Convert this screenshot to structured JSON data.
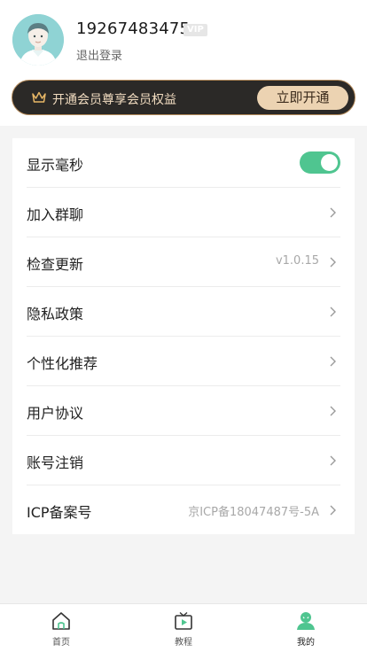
{
  "profile": {
    "phone": "19267483475",
    "vip_badge": "VIP",
    "logout_label": "退出登录"
  },
  "vip_banner": {
    "text": "开通会员尊享会员权益",
    "button_label": "立即开通"
  },
  "settings": {
    "show_ms_label": "显示毫秒",
    "show_ms_enabled": true,
    "join_group_label": "加入群聊",
    "check_update_label": "检查更新",
    "check_update_value": "v1.0.15",
    "privacy_label": "隐私政策",
    "personalized_label": "个性化推荐",
    "user_agreement_label": "用户协议",
    "account_cancel_label": "账号注销",
    "icp_label": "ICP备案号",
    "icp_value": "京ICP备18047487号-5A"
  },
  "tabs": {
    "home_label": "首页",
    "tutorial_label": "教程",
    "mine_label": "我的",
    "active": "mine"
  },
  "colors": {
    "accent_green": "#4fc590",
    "vip_dark": "#2b2927",
    "vip_gold": "#ecd3b2"
  }
}
